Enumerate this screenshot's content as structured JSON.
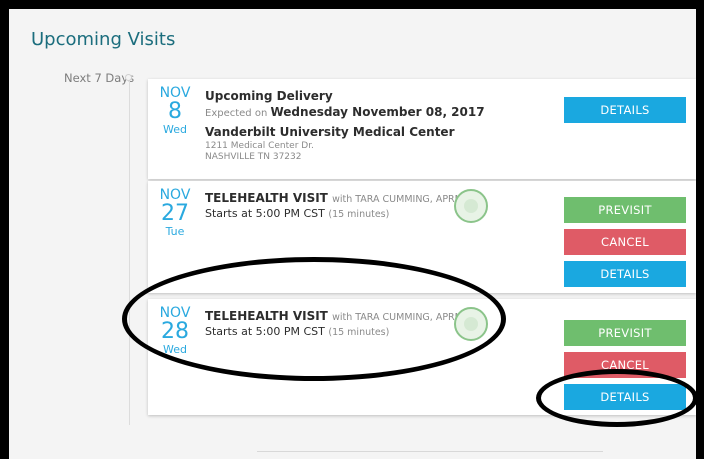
{
  "page": {
    "title": "Upcoming Visits"
  },
  "group": {
    "label": "Next 7 Days"
  },
  "visits": [
    {
      "month": "NOV",
      "day": "8",
      "weekday": "Wed",
      "title": "Upcoming Delivery",
      "expected_prefix": "Expected on",
      "expected_date": "Wednesday November 08, 2017",
      "location_name": "Vanderbilt University Medical Center",
      "address_line1": "1211 Medical Center Dr.",
      "address_line2": "NASHVILLE TN 37232",
      "details_label": "DETAILS"
    },
    {
      "month": "NOV",
      "day": "27",
      "weekday": "Tue",
      "title": "TELEHEALTH VISIT",
      "with_text": "with TARA CUMMING, APRN",
      "starts": "Starts at 5:00 PM CST",
      "duration": "(15 minutes)",
      "previsit_label": "PREVISIT",
      "cancel_label": "CANCEL",
      "details_label": "DETAILS"
    },
    {
      "month": "NOV",
      "day": "28",
      "weekday": "Wed",
      "title": "TELEHEALTH VISIT",
      "with_text": "with TARA CUMMING, APRN",
      "starts": "Starts at 5:00 PM CST",
      "duration": "(15 minutes)",
      "previsit_label": "PREVISIT",
      "cancel_label": "CANCEL",
      "details_label": "DETAILS"
    }
  ],
  "colors": {
    "accent_blue": "#1aa8e0",
    "previsit_green": "#6fbe6e",
    "cancel_red": "#df5b66",
    "title_teal": "#1b6d7d"
  }
}
